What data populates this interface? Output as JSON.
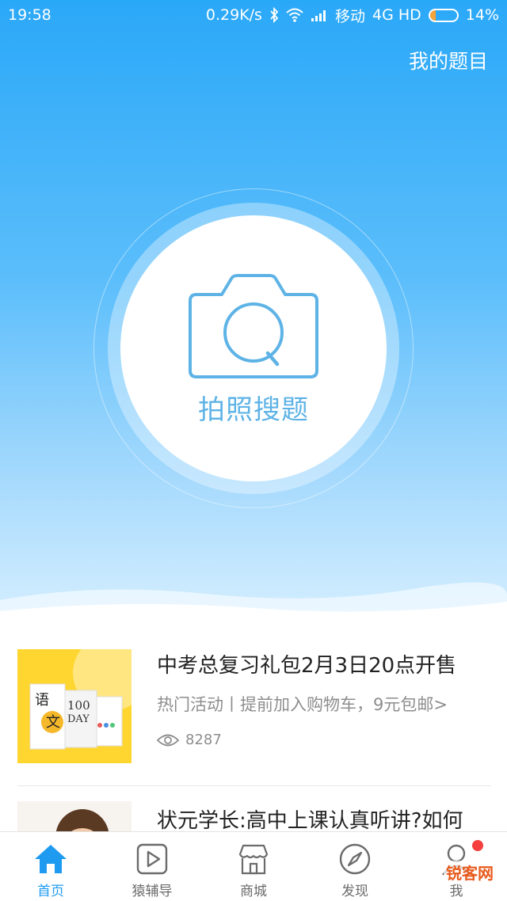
{
  "status_bar": {
    "time": "19:58",
    "speed": "0.29K/s",
    "carrier": "移动",
    "network": "4G HD",
    "battery": "14%"
  },
  "header": {
    "my_questions": "我的题目"
  },
  "capture": {
    "label": "拍照搜题",
    "icon": "camera-search-icon"
  },
  "feed": [
    {
      "title": "中考总复习礼包2月3日20点开售",
      "subtitle": "热门活动丨提前加入购物车，9元包邮>",
      "views": "8287",
      "thumb_texts": [
        "语",
        "文",
        "100",
        "DAY"
      ]
    },
    {
      "title": "状元学长:高中上课认真听讲?如何"
    }
  ],
  "tabbar": {
    "items": [
      {
        "label": "首页",
        "icon": "home-icon"
      },
      {
        "label": "猿辅导",
        "icon": "play-icon"
      },
      {
        "label": "商城",
        "icon": "store-icon"
      },
      {
        "label": "发现",
        "icon": "compass-icon"
      },
      {
        "label": "我",
        "icon": "user-icon"
      }
    ]
  },
  "watermark": "锐客网",
  "colors": {
    "accent": "#1e9bf0",
    "hero_top": "#2aa8f8",
    "camera_blue": "#5eb3e6",
    "badge_red": "#f5403f",
    "thumb_yellow": "#ffd62f"
  }
}
